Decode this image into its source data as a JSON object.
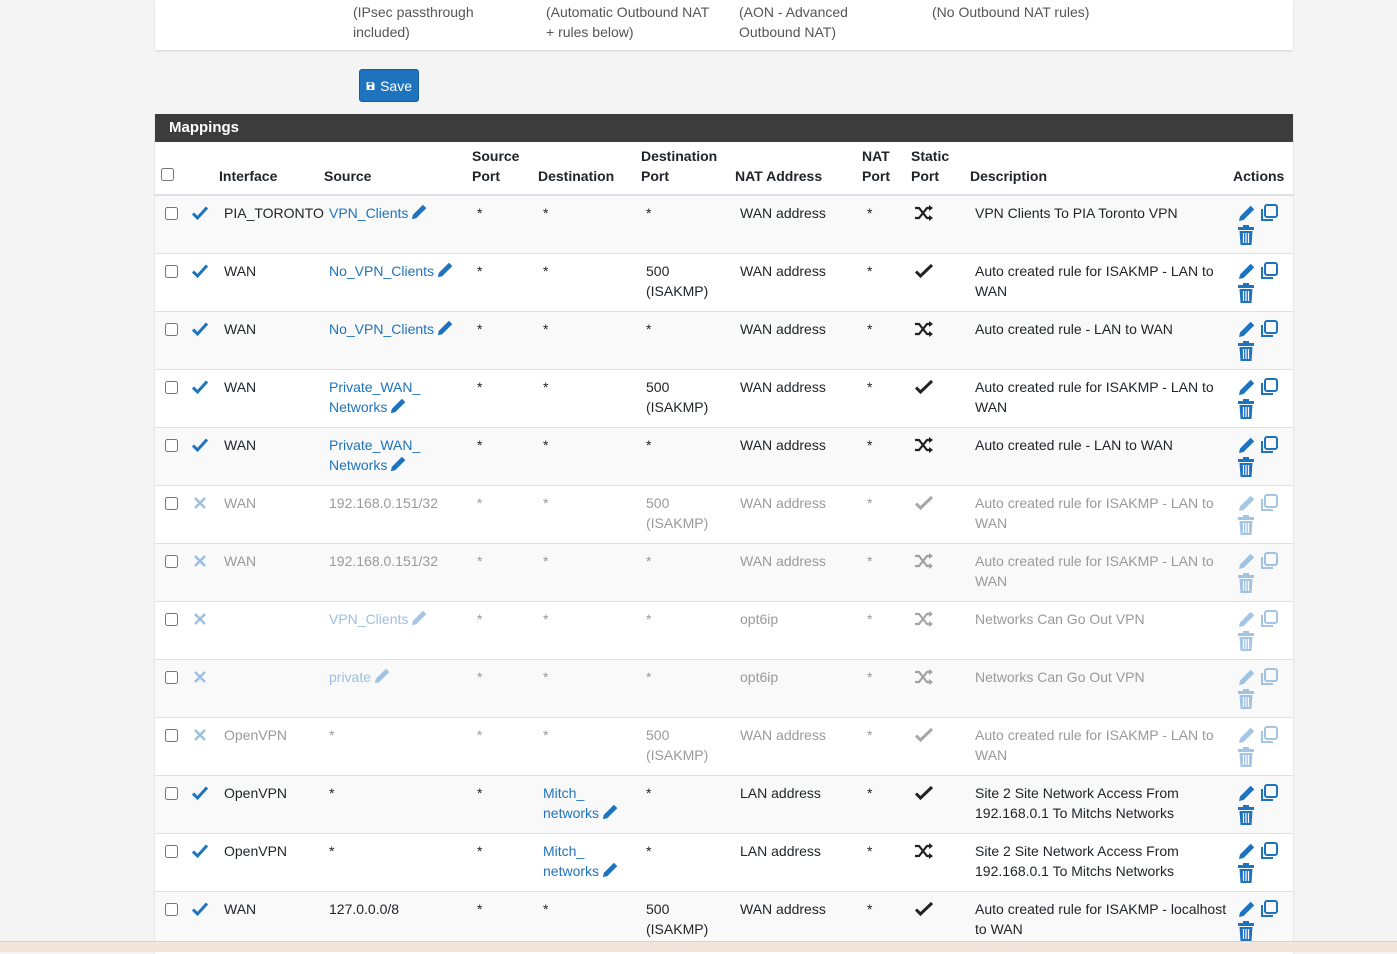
{
  "mode_notes": [
    "(IPsec passthrough included)",
    "(Automatic Outbound NAT + rules below)",
    "(AON - Advanced Outbound NAT)",
    "(No Outbound NAT rules)"
  ],
  "save_button": {
    "label": "Save"
  },
  "mappings": {
    "title": "Mappings",
    "headers": {
      "interface": "Interface",
      "source": "Source",
      "source_port": "Source Port",
      "destination": "Destination",
      "destination_port": "Destination Port",
      "nat_address": "NAT Address",
      "nat_port": "NAT Port",
      "static_port": "Static Port",
      "description": "Description",
      "actions": "Actions"
    },
    "rows": [
      {
        "enabled": true,
        "interface": "PIA_TORONTO",
        "source": "VPN_Clients",
        "source_link": true,
        "source_port": "*",
        "destination": "*",
        "destination_link": false,
        "destination_port": "*",
        "nat_address": "WAN address",
        "nat_port": "*",
        "static": "shuffle",
        "description": "VPN Clients To PIA Toronto VPN"
      },
      {
        "enabled": true,
        "interface": "WAN",
        "source": "No_VPN_Clients",
        "source_link": true,
        "source_port": "*",
        "destination": "*",
        "destination_link": false,
        "destination_port": "500 (ISAKMP)",
        "nat_address": "WAN address",
        "nat_port": "*",
        "static": "check",
        "description": "Auto created rule for ISAKMP - LAN to WAN"
      },
      {
        "enabled": true,
        "interface": "WAN",
        "source": "No_VPN_Clients",
        "source_link": true,
        "source_port": "*",
        "destination": "*",
        "destination_link": false,
        "destination_port": "*",
        "nat_address": "WAN address",
        "nat_port": "*",
        "static": "shuffle",
        "description": "Auto created rule - LAN to WAN"
      },
      {
        "enabled": true,
        "interface": "WAN",
        "source": "Private_WAN_ Networks",
        "source_link": true,
        "source_port": "*",
        "destination": "*",
        "destination_link": false,
        "destination_port": "500 (ISAKMP)",
        "nat_address": "WAN address",
        "nat_port": "*",
        "static": "check",
        "description": "Auto created rule for ISAKMP - LAN to WAN"
      },
      {
        "enabled": true,
        "interface": "WAN",
        "source": "Private_WAN_ Networks",
        "source_link": true,
        "source_port": "*",
        "destination": "*",
        "destination_link": false,
        "destination_port": "*",
        "nat_address": "WAN address",
        "nat_port": "*",
        "static": "shuffle",
        "description": "Auto created rule - LAN to WAN"
      },
      {
        "enabled": false,
        "interface": "WAN",
        "source": "192.168.0.151/32",
        "source_link": false,
        "source_port": "*",
        "destination": "*",
        "destination_link": false,
        "destination_port": "500 (ISAKMP)",
        "nat_address": "WAN address",
        "nat_port": "*",
        "static": "check",
        "description": "Auto created rule for ISAKMP - LAN to WAN"
      },
      {
        "enabled": false,
        "interface": "WAN",
        "source": "192.168.0.151/32",
        "source_link": false,
        "source_port": "*",
        "destination": "*",
        "destination_link": false,
        "destination_port": "*",
        "nat_address": "WAN address",
        "nat_port": "*",
        "static": "shuffle",
        "description": "Auto created rule for ISAKMP - LAN to WAN"
      },
      {
        "enabled": false,
        "interface": "",
        "source": "VPN_Clients",
        "source_link": true,
        "source_port": "*",
        "destination": "*",
        "destination_link": false,
        "destination_port": "*",
        "nat_address": "opt6ip",
        "nat_port": "*",
        "static": "shuffle",
        "description": "Networks Can Go Out VPN"
      },
      {
        "enabled": false,
        "interface": "",
        "source": "private",
        "source_link": true,
        "source_port": "*",
        "destination": "*",
        "destination_link": false,
        "destination_port": "*",
        "nat_address": "opt6ip",
        "nat_port": "*",
        "static": "shuffle",
        "description": "Networks Can Go Out VPN"
      },
      {
        "enabled": false,
        "interface": "OpenVPN",
        "source": "*",
        "source_link": false,
        "source_port": "*",
        "destination": "*",
        "destination_link": false,
        "destination_port": "500 (ISAKMP)",
        "nat_address": "WAN address",
        "nat_port": "*",
        "static": "check",
        "description": "Auto created rule for ISAKMP - LAN to WAN"
      },
      {
        "enabled": true,
        "interface": "OpenVPN",
        "source": "*",
        "source_link": false,
        "source_port": "*",
        "destination": "Mitch_ networks",
        "destination_link": true,
        "destination_port": "*",
        "nat_address": "LAN address",
        "nat_port": "*",
        "static": "check",
        "description": "Site 2 Site Network Access From 192.168.0.1 To Mitchs Networks"
      },
      {
        "enabled": true,
        "interface": "OpenVPN",
        "source": "*",
        "source_link": false,
        "source_port": "*",
        "destination": "Mitch_ networks",
        "destination_link": true,
        "destination_port": "*",
        "nat_address": "LAN address",
        "nat_port": "*",
        "static": "shuffle",
        "description": "Site 2 Site Network Access From 192.168.0.1 To Mitchs Networks"
      },
      {
        "enabled": true,
        "interface": "WAN",
        "source": "127.0.0.0/8",
        "source_link": false,
        "source_port": "*",
        "destination": "*",
        "destination_link": false,
        "destination_port": "500 (ISAKMP)",
        "nat_address": "WAN address",
        "nat_port": "*",
        "static": "check",
        "description": "Auto created rule for ISAKMP - localhost to WAN"
      }
    ]
  },
  "colors": {
    "accent": "#1e73be",
    "header_bar": "#3c3c3c",
    "enabled_check": "#1e73be",
    "disabled_x": "#9dbfe0"
  }
}
